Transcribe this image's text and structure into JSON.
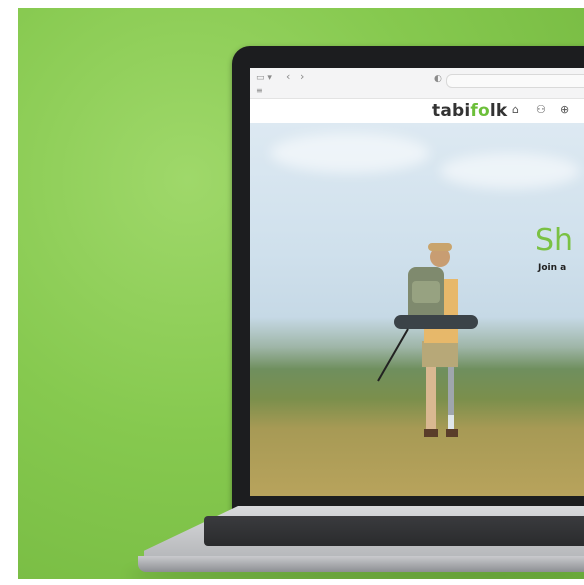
{
  "background": {
    "color": "#86c94f"
  },
  "browser": {
    "sidebar_icon": "sidebar-icon",
    "back_icon": "‹",
    "forward_icon": "›",
    "menu_icon": "≡",
    "shield_icon": "◐"
  },
  "site": {
    "logo_part1": "tabi",
    "logo_part2": "fo",
    "logo_part3": "lk",
    "brand_color": "#7ac143",
    "nav_icons": [
      "home-icon",
      "community-icon",
      "globe-icon",
      "star-icon"
    ]
  },
  "hero": {
    "title": "Sh",
    "subtitle": "Join a"
  }
}
